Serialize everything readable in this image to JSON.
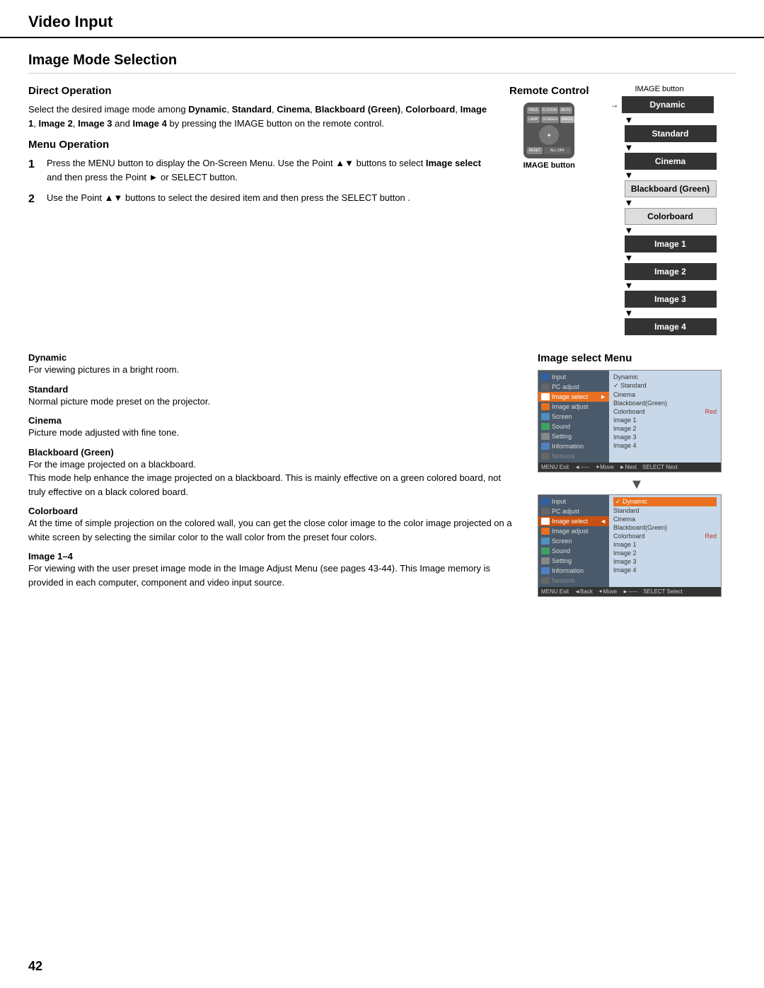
{
  "header": {
    "title": "Video Input",
    "page_number": "42"
  },
  "main_section": {
    "title": "Image Mode Selection"
  },
  "direct_operation": {
    "title": "Direct Operation",
    "text_parts": [
      "Select the desired image mode among ",
      "Dynamic",
      ", ",
      "Standard",
      ", ",
      "Cinema",
      ", ",
      "Blackboard (Green)",
      ", ",
      "Colorboard",
      ", ",
      "Image 1",
      ", ",
      "Image 2",
      ", ",
      "Image 3",
      " and ",
      "Image 4",
      " by pressing the IMAGE button on the remote control."
    ]
  },
  "menu_operation": {
    "title": "Menu Operation",
    "steps": [
      {
        "num": "1",
        "text": "Press the MENU button to display the On-Screen Menu. Use the Point ▲▼ buttons to select Image select and then press the Point ► or SELECT button."
      },
      {
        "num": "2",
        "text": "Use the Point ▲▼ buttons to select  the desired item and then press the SELECT button ."
      }
    ]
  },
  "remote_control": {
    "title": "Remote Control",
    "image_button_label": "IMAGE button",
    "image_button_label2": "IMAGE button"
  },
  "flow_diagram": {
    "items": [
      "Dynamic",
      "Standard",
      "Cinema",
      "Blackboard (Green)",
      "Colorboard",
      "Image 1",
      "Image 2",
      "Image 3",
      "Image 4"
    ]
  },
  "descriptions": [
    {
      "title": "Dynamic",
      "text": "For viewing pictures in a bright room."
    },
    {
      "title": "Standard",
      "text": "Normal picture mode preset on the projector."
    },
    {
      "title": "Cinema",
      "text": "Picture mode adjusted with fine tone."
    },
    {
      "title": "Blackboard (Green)",
      "text": "For the image projected on a blackboard.\nThis mode help enhance the image projected on a blackboard. This is mainly effective on a green colored board, not truly effective on a black colored board."
    },
    {
      "title": "Colorboard",
      "text": "At the time of simple projection on the colored wall, you can get the close color image to the color image projected on a white screen by selecting the similar color to the wall color from the preset four colors."
    },
    {
      "title": "Image 1–4",
      "text": "For viewing with the user preset image mode in the Image Adjust Menu (see pages 43-44). This Image memory is provided in each computer, component and video input source."
    }
  ],
  "image_select_menu": {
    "title": "Image select Menu",
    "menu1": {
      "items": [
        "Input",
        "PC adjust",
        "Image select",
        "Image adjust",
        "Screen",
        "Sound",
        "Setting",
        "Information",
        "Network"
      ],
      "right_items": [
        "Dynamic",
        "✓ Standard",
        "Cinema",
        "Blackboard(Green)",
        "Colorboard    Red",
        "Image 1",
        "Image 2",
        "Image 3",
        "Image 4"
      ],
      "bar": "MENU Exit   ◄-----   ✦Move   ►Next   SELECT Next"
    },
    "menu2": {
      "items": [
        "Input",
        "PC adjust",
        "Image select",
        "Image adjust",
        "Screen",
        "Sound",
        "Setting",
        "Information",
        "Network"
      ],
      "right_items": [
        "✓ Dynamic",
        "Standard",
        "Cinema",
        "Blackboard(Green)",
        "Colorboard    Red",
        "Image 1",
        "Image 2",
        "Image 3",
        "Image 4"
      ],
      "bar": "MENU Exit   ◄Back   ✦Move   ►-----   SELECT Select"
    }
  }
}
